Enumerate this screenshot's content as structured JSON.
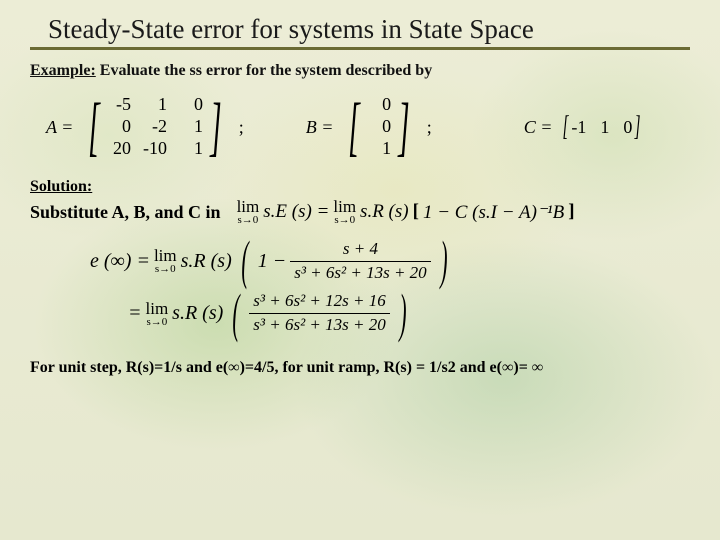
{
  "title": "Steady-State error for systems in State Space",
  "example": {
    "lead": "Example:",
    "rest": " Evaluate the ss error for the system described by"
  },
  "matrices": {
    "A_label": "A =",
    "A": [
      [
        "-5",
        "1",
        "0"
      ],
      [
        "0",
        "-2",
        "1"
      ],
      [
        "20",
        "-10",
        "1"
      ]
    ],
    "semi1": ";",
    "B_label": "B =",
    "B": [
      [
        "0"
      ],
      [
        "0"
      ],
      [
        "1"
      ]
    ],
    "semi2": ";",
    "C_label": "C =",
    "C": [
      "-1",
      "1",
      "0"
    ]
  },
  "solution": {
    "lead": "Solution:"
  },
  "substitute": "Substitute  A, B, and C in",
  "formula_main": {
    "lim": "lim",
    "sub": "s→0",
    "lhs": "s.E (s) =",
    "rhs_pre": "s.R (s)",
    "bracket_open": "[",
    "inner": "1 − C (s.I − A)⁻¹B",
    "bracket_close": "]"
  },
  "eq1": {
    "lhs": "e (∞) =",
    "lim": "lim",
    "sub": "s→0",
    "pre": "s.R (s)",
    "one": "1 −",
    "num": "s + 4",
    "den": "s³ + 6s² + 13s + 20"
  },
  "eq2": {
    "eq": "=",
    "lim": "lim",
    "sub": "s→0",
    "pre": "s.R (s)",
    "num": "s³ + 6s² + 12s + 16",
    "den": "s³ + 6s² + 13s + 20"
  },
  "final": "For unit step, R(s)=1/s and e(∞)=4/5, for unit ramp, R(s) = 1/s2 and e(∞)= ∞"
}
